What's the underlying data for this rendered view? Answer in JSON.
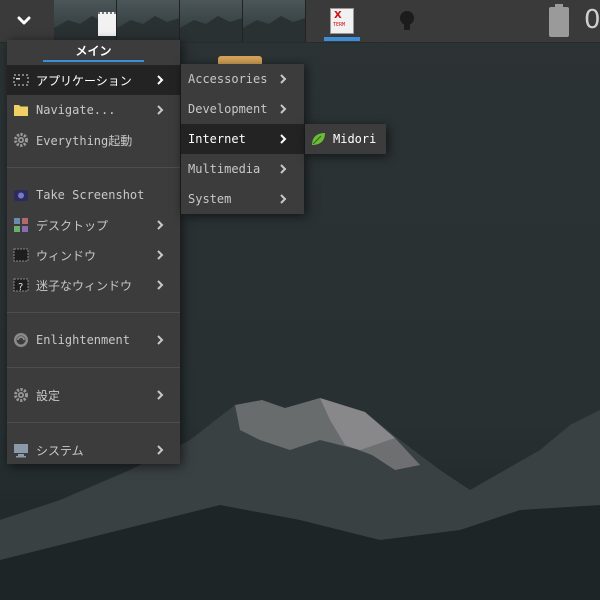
{
  "shelf": {
    "start_icon": "chevron-down-icon",
    "pager_count": 4,
    "task_icon": "xterm-icon",
    "xterm_badge_letter": "X",
    "xterm_badge_text": "TERM",
    "clock_partial": "0"
  },
  "main_menu": {
    "title": "メイン",
    "items": [
      {
        "label": "アプリケーション",
        "icon": "applications-icon",
        "submenu": true,
        "highlighted": true
      },
      {
        "label": "Navigate...",
        "icon": "folder-icon",
        "submenu": true
      },
      {
        "label": "Everything起動",
        "icon": "gear-icon",
        "submenu": false
      },
      {
        "label": "Take Screenshot",
        "icon": "screenshot-icon",
        "submenu": false
      },
      {
        "label": "デスクトップ",
        "icon": "desktop-icon",
        "submenu": true
      },
      {
        "label": "ウィンドウ",
        "icon": "window-icon",
        "submenu": true
      },
      {
        "label": "迷子なウィンドウ",
        "icon": "lost-window-icon",
        "submenu": true
      },
      {
        "label": "Enlightenment",
        "icon": "enlightenment-icon",
        "submenu": true
      },
      {
        "label": "設定",
        "icon": "settings-gear-icon",
        "submenu": true
      },
      {
        "label": "システム",
        "icon": "computer-icon",
        "submenu": true
      }
    ]
  },
  "apps_menu": {
    "items": [
      {
        "label": "Accessories",
        "submenu": true
      },
      {
        "label": "Development",
        "submenu": true
      },
      {
        "label": "Internet",
        "submenu": true,
        "highlighted": true
      },
      {
        "label": "Multimedia",
        "submenu": true
      },
      {
        "label": "System",
        "submenu": true
      }
    ]
  },
  "internet_menu": {
    "items": [
      {
        "label": "Midori",
        "icon": "midori-leaf-icon"
      }
    ]
  },
  "colors": {
    "menu_bg": "#3c3c3c",
    "menu_highlight": "#232323",
    "accent": "#3a8fd8",
    "text": "#c8c8c8"
  }
}
